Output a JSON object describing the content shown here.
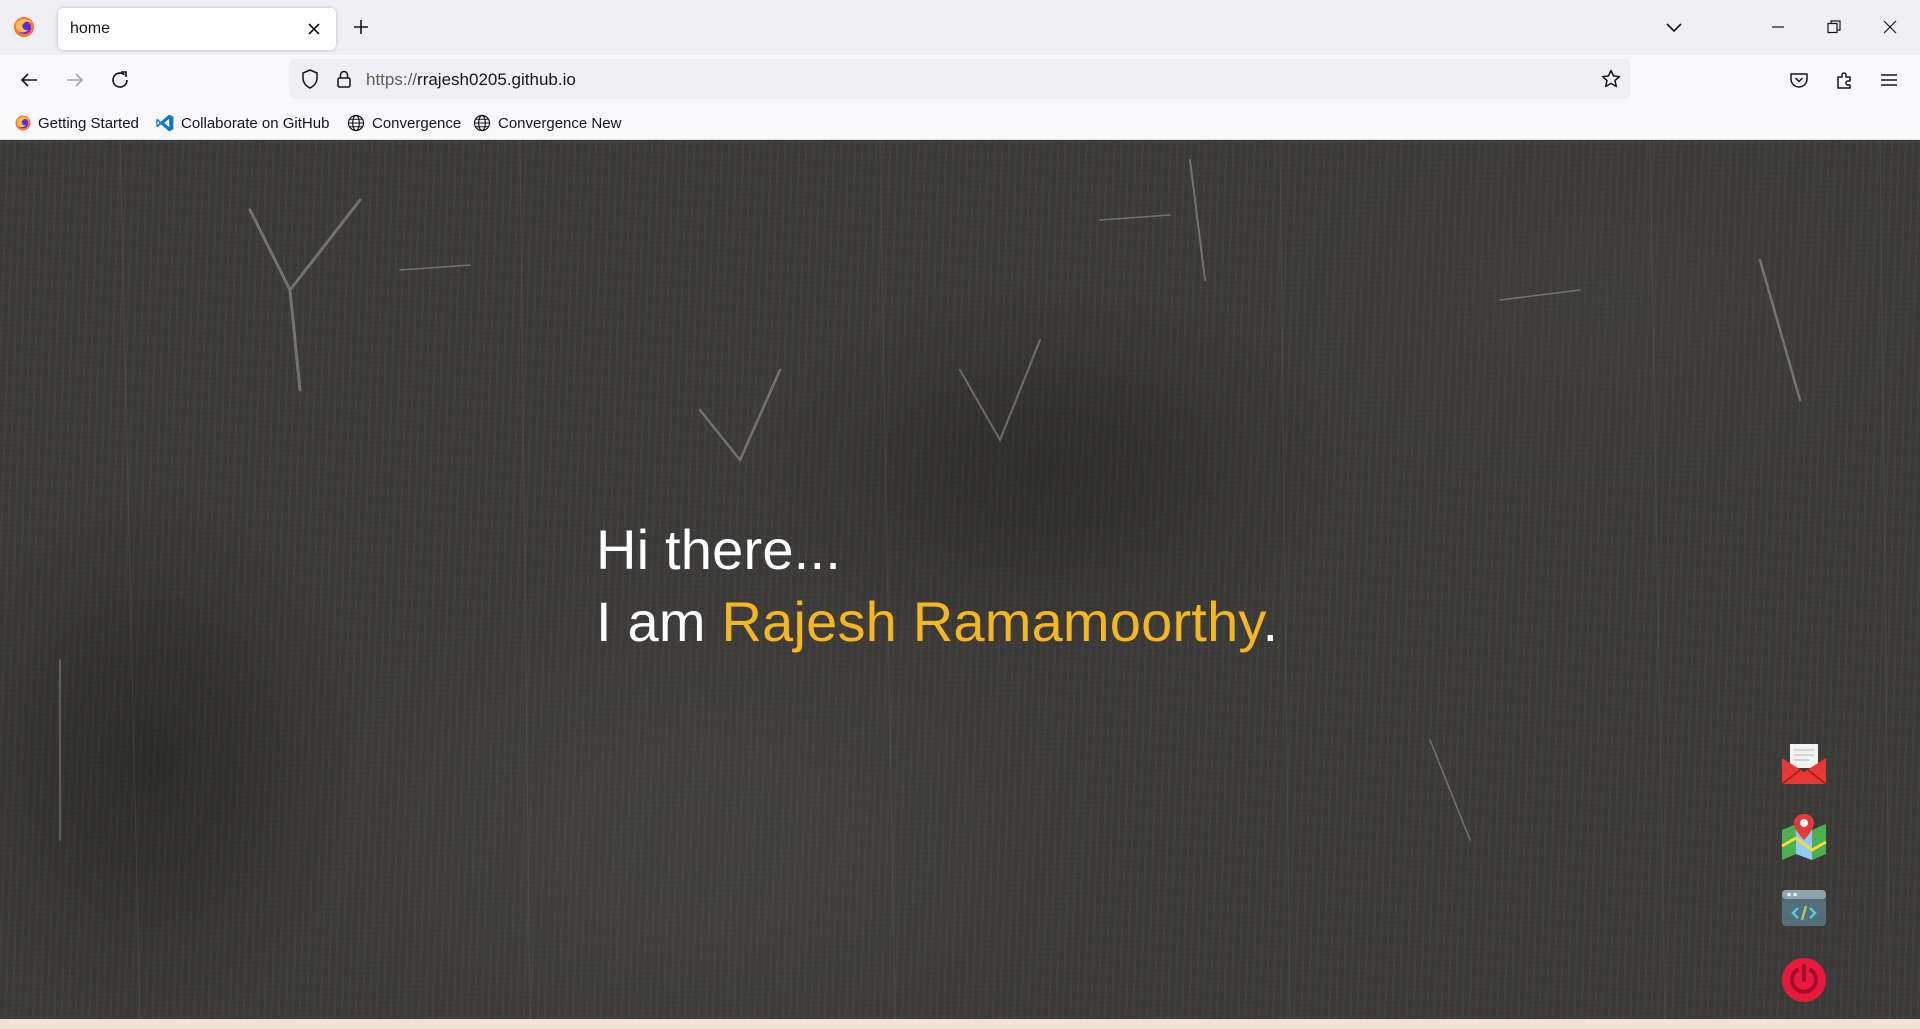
{
  "browser": {
    "tab": {
      "title": "home",
      "close_label": "close-tab"
    },
    "address": {
      "scheme": "https://",
      "host": "rrajesh0205.github.io"
    },
    "bookmarks": [
      {
        "label": "Getting Started",
        "icon": "firefox-icon"
      },
      {
        "label": "Collaborate on GitHub",
        "icon": "vscode-icon"
      },
      {
        "label": "Convergence",
        "icon": "globe-icon"
      },
      {
        "label": "Convergence New",
        "icon": "globe-icon"
      }
    ]
  },
  "page": {
    "line1": "Hi there...",
    "line2_prefix": "I am ",
    "name": "Rajesh Ramamoorthy",
    "line2_suffix": ".",
    "accent_color": "#f5b81c",
    "side_icons": [
      "mail-icon",
      "map-icon",
      "code-window-icon",
      "power-icon"
    ]
  }
}
